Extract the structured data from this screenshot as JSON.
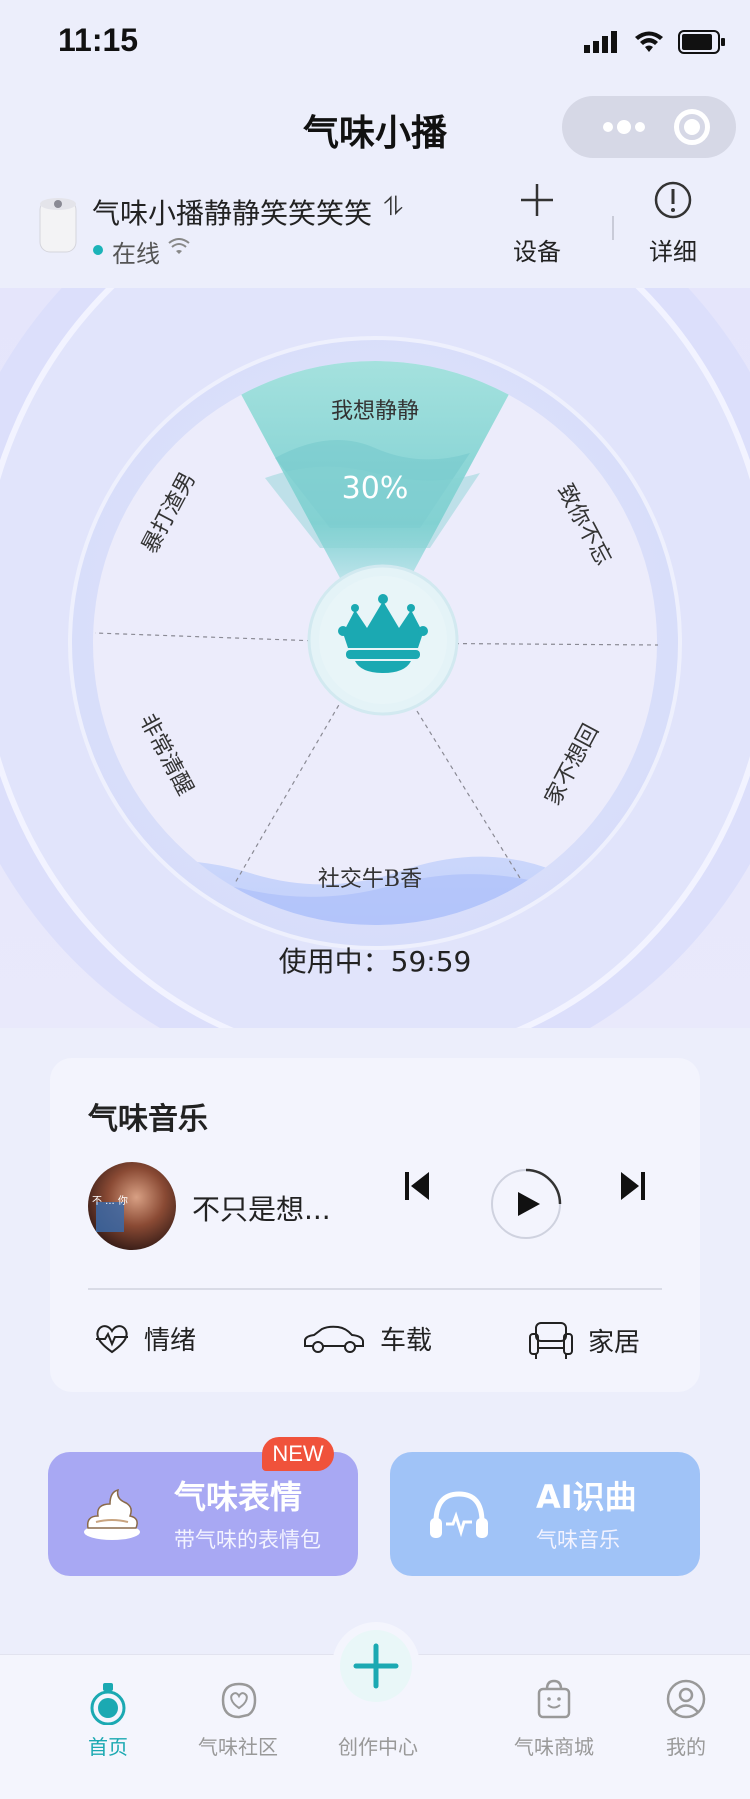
{
  "status_bar": {
    "time": "11:15"
  },
  "header": {
    "title": "气味小播"
  },
  "device": {
    "name": "气味小播静静笑笑笑笑",
    "swap_symbol": "⥮",
    "status": "在线",
    "add_label": "设备",
    "detail_label": "详细"
  },
  "wheel": {
    "segments": [
      "我想静静",
      "致你不忘",
      "家不想回",
      "社交牛B香",
      "非常清醒",
      "暴打渣男"
    ],
    "active_segment": "我想静静",
    "level": "30%",
    "level_value": 0.3,
    "usage_text": "使用中：59:59",
    "accent": "#1ba9b2"
  },
  "music": {
    "title": "气味音乐",
    "song": "不只是想...",
    "album_caption": "不 ... 你",
    "categories": [
      "情绪",
      "车载",
      "家居"
    ]
  },
  "features": [
    {
      "title": "气味表情",
      "subtitle": "带气味的表情包",
      "badge": "NEW"
    },
    {
      "title": "AI识曲",
      "subtitle": "气味音乐"
    }
  ],
  "nav": {
    "items": [
      "首页",
      "气味社区",
      "创作中心",
      "气味商城",
      "我的"
    ],
    "active": "首页"
  }
}
